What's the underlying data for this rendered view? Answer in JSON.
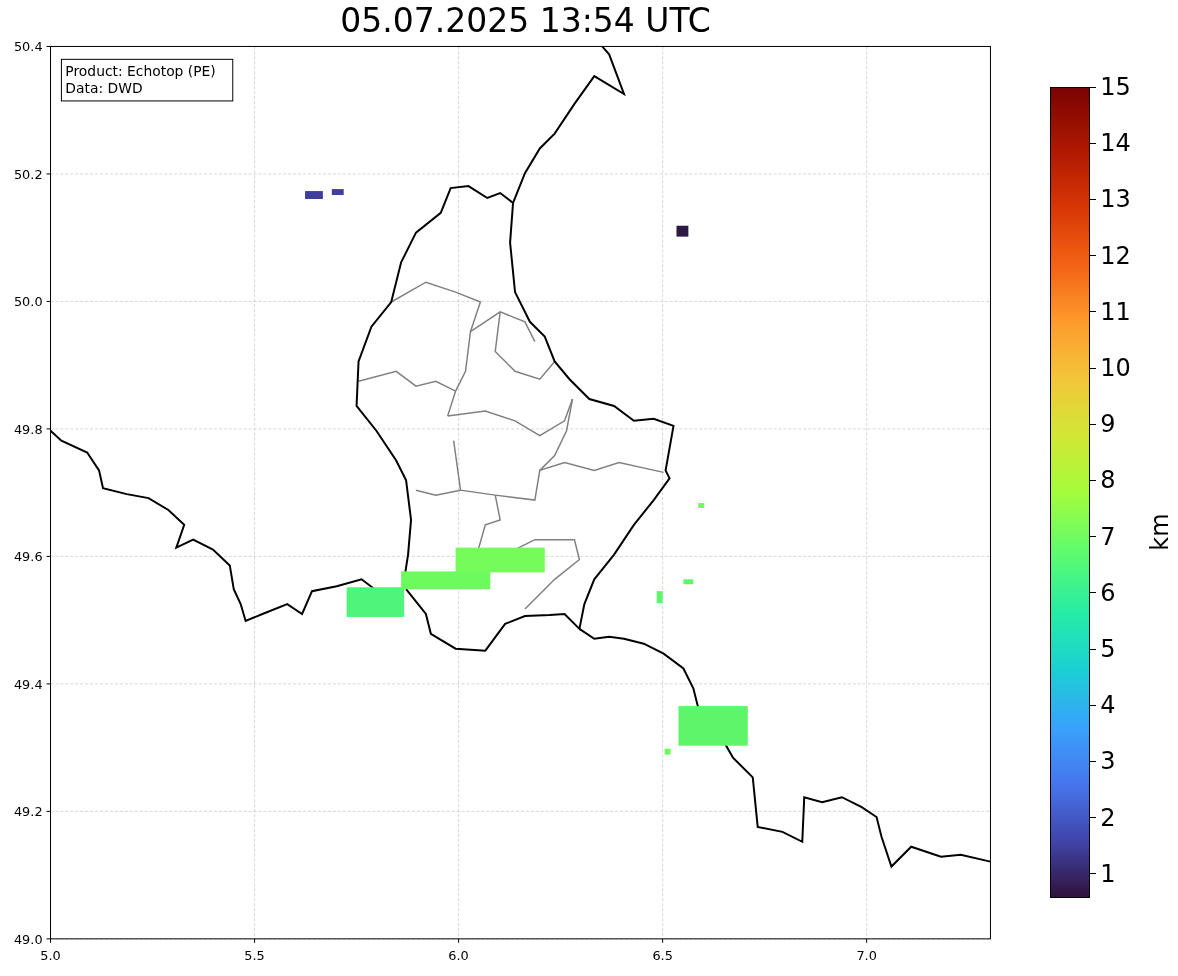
{
  "title": "05.07.2025 13:54 UTC",
  "info_box": [
    "Product: Echotop (PE)",
    "Data: DWD"
  ],
  "x_ticks": [
    "5.0",
    "5.5",
    "6.0",
    "6.5",
    "7.0"
  ],
  "y_ticks": [
    "50.4",
    "50.2",
    "50.0",
    "49.8",
    "49.6",
    "49.4",
    "49.2",
    "49.0"
  ],
  "colorbar": {
    "label": "km",
    "ticks": [
      "15",
      "14",
      "13",
      "12",
      "11",
      "10",
      "9",
      "8",
      "7",
      "6",
      "5",
      "4",
      "3",
      "2",
      "1"
    ]
  }
}
